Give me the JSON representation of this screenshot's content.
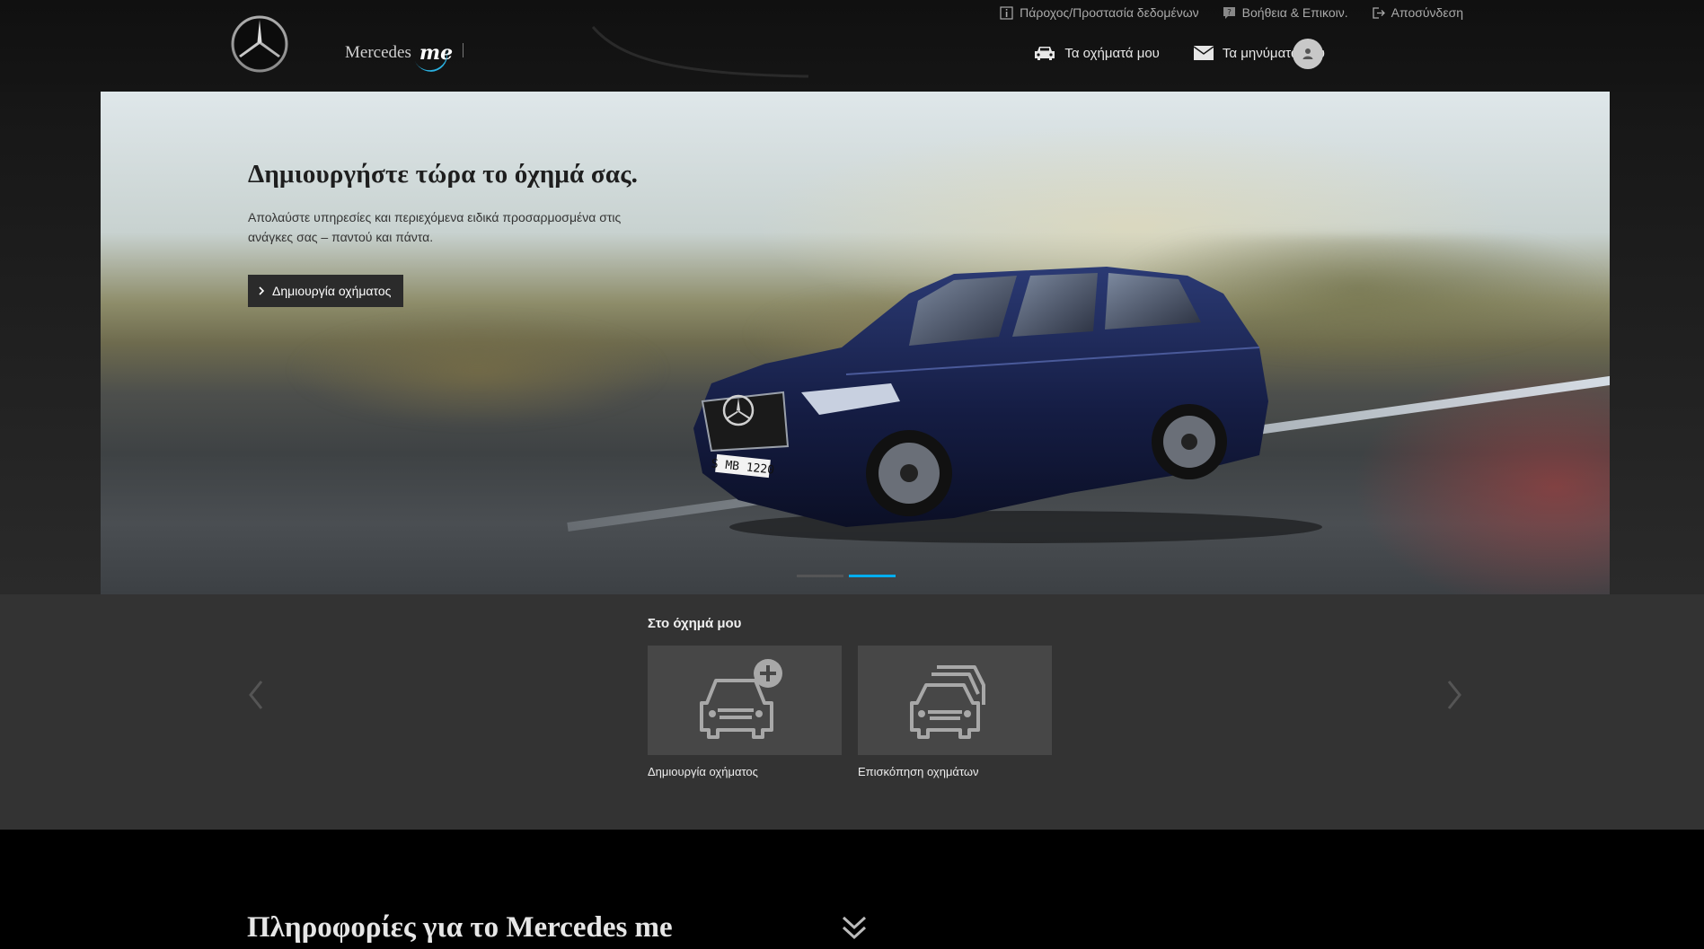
{
  "header": {
    "brand_name": "Mercedes",
    "brand_me": "me",
    "util_links": [
      {
        "icon": "info-icon",
        "label": "Πάροχος/Προστασία δεδομένων"
      },
      {
        "icon": "help-icon",
        "label": "Βοήθεια & Επικοιν."
      },
      {
        "icon": "logout-icon",
        "label": "Αποσύνδεση"
      }
    ],
    "nav": [
      {
        "icon": "car-icon",
        "label": "Τα οχήματά μου"
      },
      {
        "icon": "envelope-icon",
        "label": "Τα μηνύματά μου"
      }
    ]
  },
  "hero": {
    "title": "Δημιουργήστε τώρα το όχημά σας.",
    "description": "Απολαύστε υπηρεσίες και περιεχόμενα ειδικά προσαρμοσμένα στις ανάγκες σας – παντού και πάντα.",
    "button_label": "Δημιουργία οχήματος",
    "license_plate": "S MB 1220"
  },
  "vehicle_section": {
    "title": "Στο όχημά μου",
    "tiles": [
      {
        "icon": "car-add-icon",
        "label": "Δημιουργία οχήματος"
      },
      {
        "icon": "cars-overview-icon",
        "label": "Επισκόπηση οχημάτων"
      }
    ]
  },
  "info_section": {
    "title": "Πληροφορίες για το Mercedes me"
  },
  "colors": {
    "accent": "#00adef",
    "header_bg": "#101010",
    "section_bg": "#333333",
    "tile_bg": "#474747"
  }
}
